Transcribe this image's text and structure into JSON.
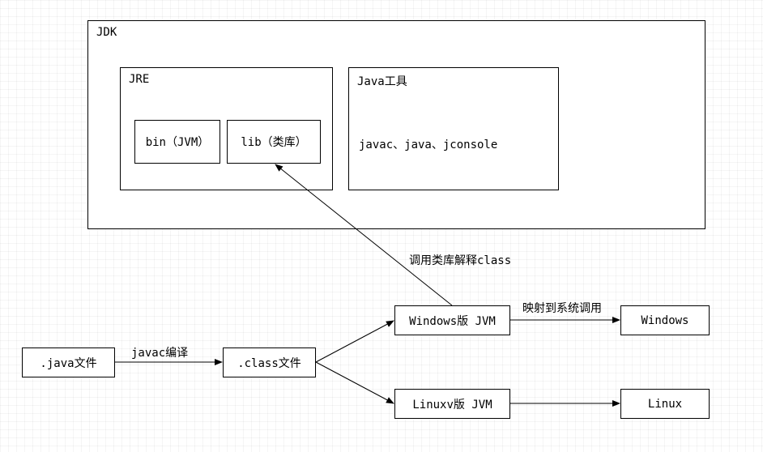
{
  "jdk": {
    "title": "JDK"
  },
  "jre": {
    "title": "JRE",
    "bin": "bin（JVM）",
    "lib": "lib（类库）"
  },
  "tools": {
    "title": "Java工具",
    "body": "javac、java、jconsole"
  },
  "flow": {
    "java_file": ".java文件",
    "javac_compile": "javac编译",
    "class_file": ".class文件",
    "invoke_lib": "调用类库解释class",
    "jvm_win": "Windows版 JVM",
    "map_syscall": "映射到系统调用",
    "windows": "Windows",
    "jvm_linux": "Linuxv版 JVM",
    "linux": "Linux"
  }
}
